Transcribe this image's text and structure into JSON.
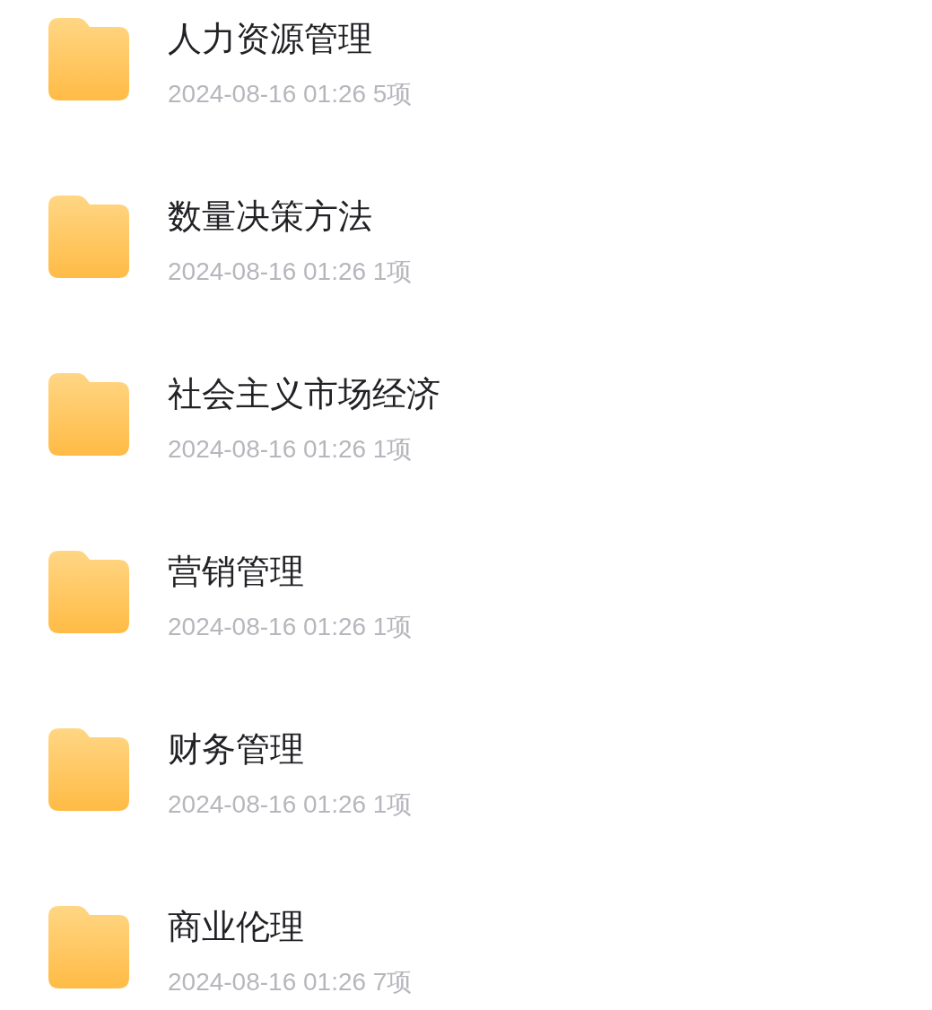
{
  "folders": [
    {
      "name": "人力资源管理",
      "meta": "2024-08-16 01:26 5项"
    },
    {
      "name": "数量决策方法",
      "meta": "2024-08-16 01:26 1项"
    },
    {
      "name": "社会主义市场经济",
      "meta": "2024-08-16 01:26 1项"
    },
    {
      "name": "营销管理",
      "meta": "2024-08-16 01:26 1项"
    },
    {
      "name": "财务管理",
      "meta": "2024-08-16 01:26 1项"
    },
    {
      "name": "商业伦理",
      "meta": "2024-08-16 01:26 7项"
    }
  ]
}
